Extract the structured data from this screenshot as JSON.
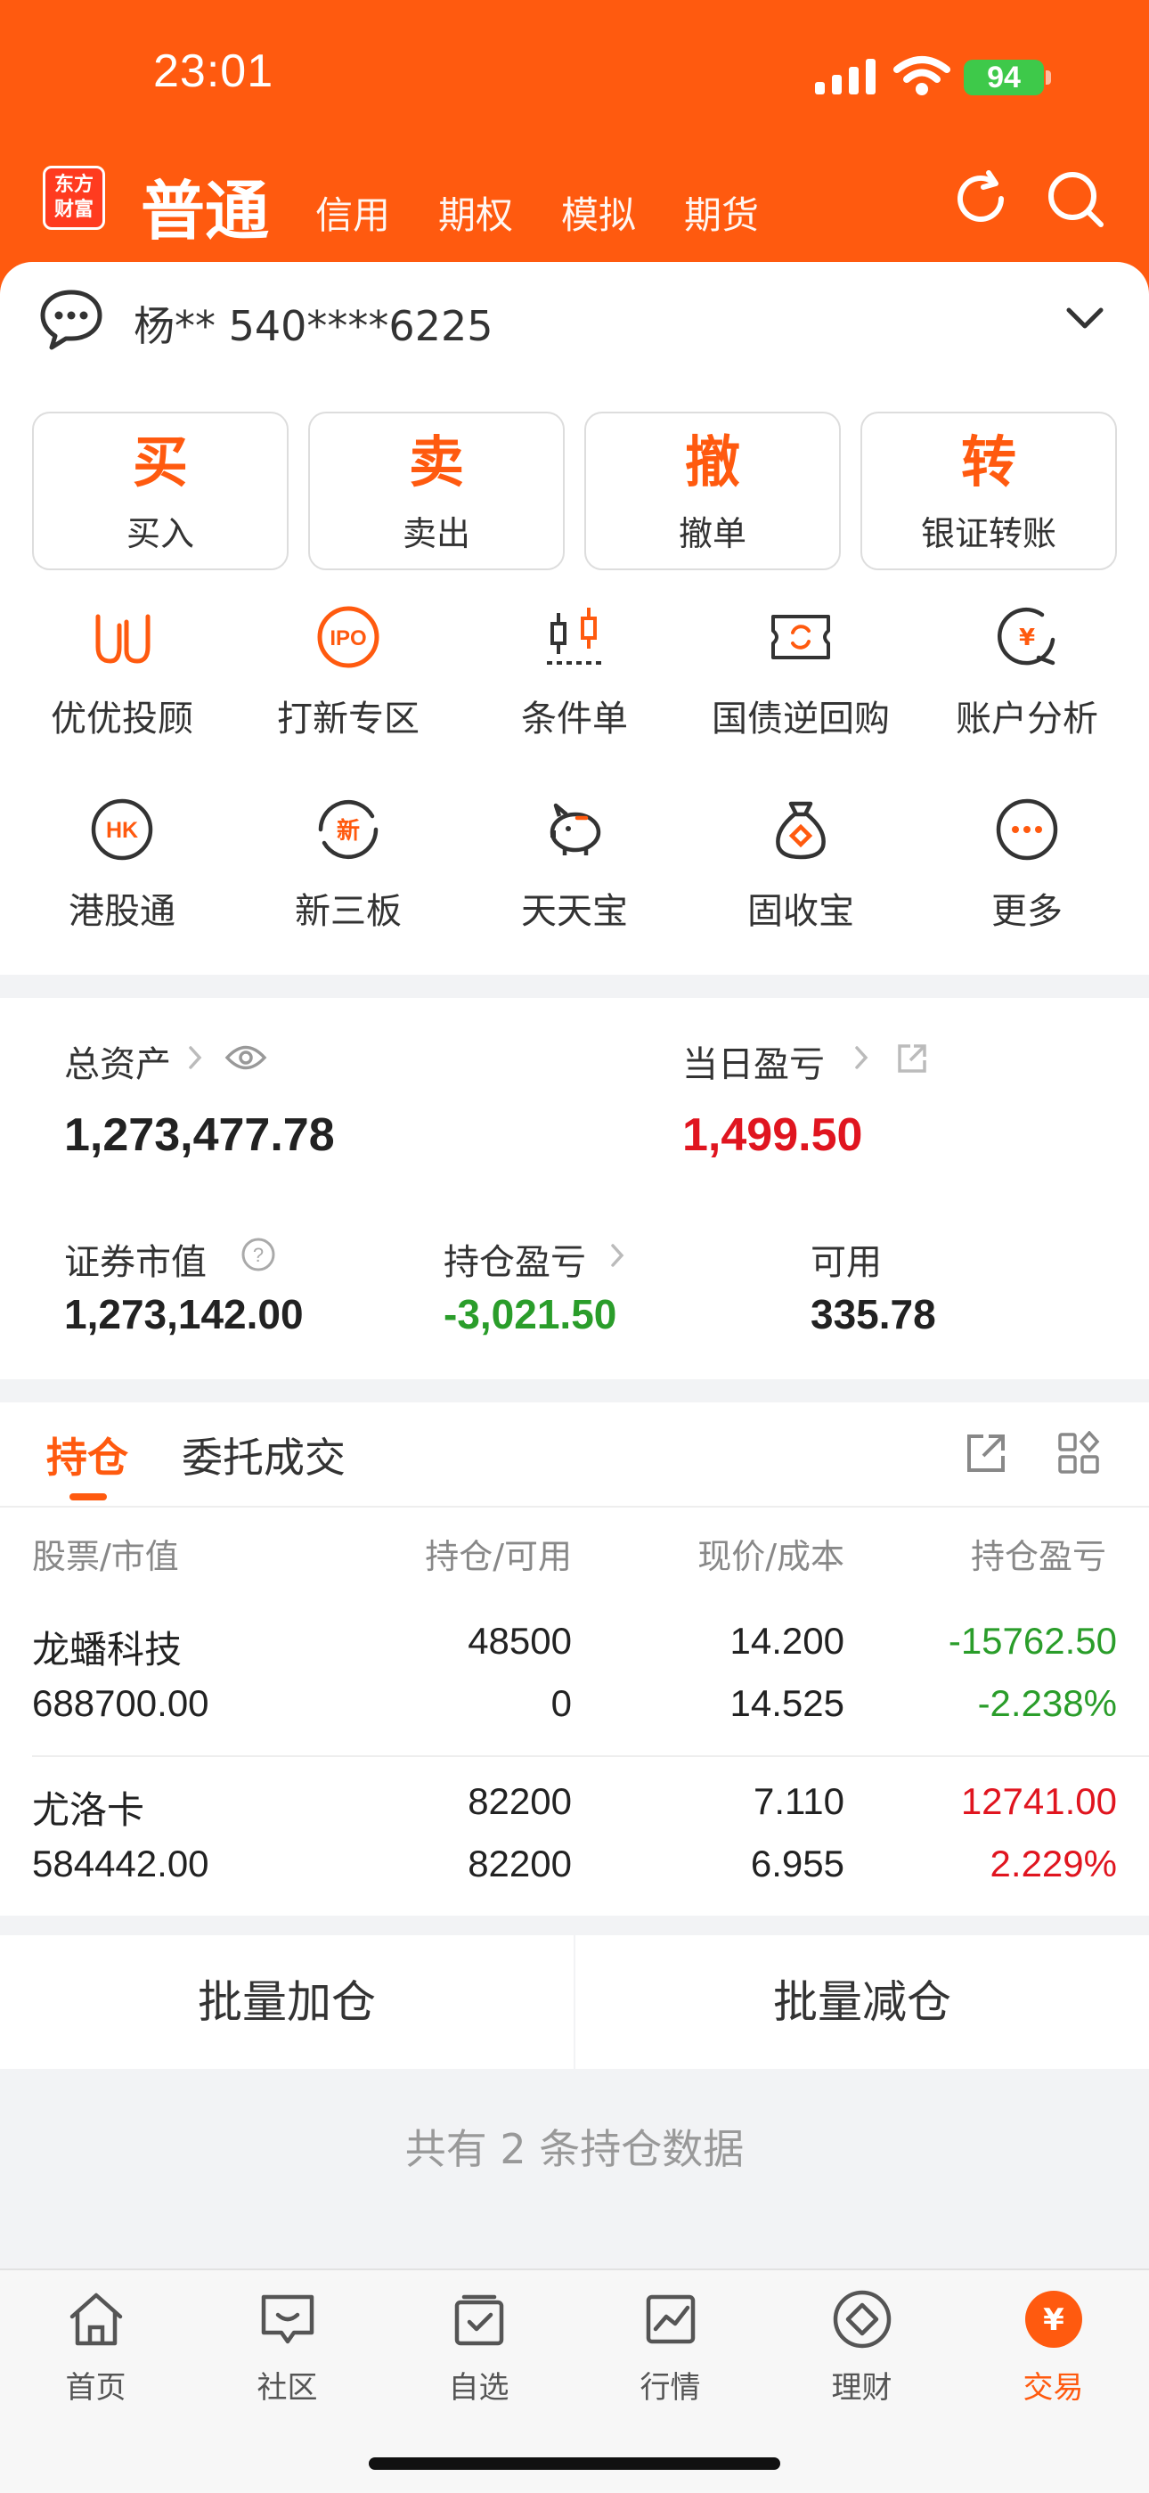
{
  "status": {
    "time": "23:01",
    "battery": "94"
  },
  "header": {
    "logo": "东方财富",
    "active_tab": "普通",
    "tabs": [
      "信用",
      "期权",
      "模拟",
      "期货"
    ]
  },
  "account": {
    "label": "杨** 540****6225"
  },
  "actions": [
    {
      "glyph": "买",
      "label": "买入"
    },
    {
      "glyph": "卖",
      "label": "卖出"
    },
    {
      "glyph": "撤",
      "label": "撤单"
    },
    {
      "glyph": "转",
      "label": "银证转账"
    }
  ],
  "grid": [
    {
      "label": "优优投顾",
      "icon": "uu-advisor-icon"
    },
    {
      "label": "打新专区",
      "icon": "ipo-icon"
    },
    {
      "label": "条件单",
      "icon": "candlestick-icon"
    },
    {
      "label": "国债逆回购",
      "icon": "repo-icon"
    },
    {
      "label": "账户分析",
      "icon": "account-analysis-icon"
    },
    {
      "label": "港股通",
      "icon": "hk-icon"
    },
    {
      "label": "新三板",
      "icon": "new-board-icon"
    },
    {
      "label": "天天宝",
      "icon": "piggy-bank-icon"
    },
    {
      "label": "固收宝",
      "icon": "money-bag-icon"
    },
    {
      "label": "更多",
      "icon": "more-icon"
    }
  ],
  "assets": {
    "total_label": "总资产",
    "total_value": "1,273,477.78",
    "daily_label": "当日盈亏",
    "daily_value": "1,499.50",
    "market_label": "证券市值",
    "market_value": "1,273,142.00",
    "position_pl_label": "持仓盈亏",
    "position_pl_value": "-3,021.50",
    "available_label": "可用",
    "available_value": "335.78"
  },
  "holdings": {
    "tabs": [
      "持仓",
      "委托成交"
    ],
    "headers": [
      "股票/市值",
      "持仓/可用",
      "现价/成本",
      "持仓盈亏"
    ],
    "rows": [
      {
        "name": "龙蟠科技",
        "market_value": "688700.00",
        "position": "48500",
        "available": "0",
        "price": "14.200",
        "cost": "14.525",
        "pl": "-15762.50",
        "pl_pct": "-2.238%"
      },
      {
        "name": "尤洛卡",
        "market_value": "584442.00",
        "position": "82200",
        "available": "82200",
        "price": "7.110",
        "cost": "6.955",
        "pl": "12741.00",
        "pl_pct": "2.229%"
      }
    ]
  },
  "batch": {
    "add": "批量加仓",
    "reduce": "批量减仓"
  },
  "summary": "共有 2 条持仓数据",
  "bottom_nav": [
    {
      "label": "首页",
      "icon": "home-icon"
    },
    {
      "label": "社区",
      "icon": "community-icon"
    },
    {
      "label": "自选",
      "icon": "watchlist-icon"
    },
    {
      "label": "行情",
      "icon": "market-icon"
    },
    {
      "label": "理财",
      "icon": "wealth-icon"
    },
    {
      "label": "交易",
      "icon": "trade-icon"
    }
  ],
  "colors": {
    "brand": "#ff5a0f",
    "up": "#e0151f",
    "down": "#2a9d2a"
  }
}
